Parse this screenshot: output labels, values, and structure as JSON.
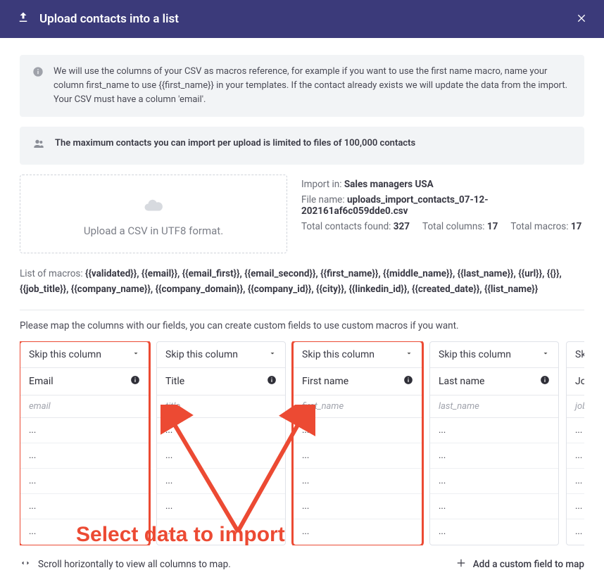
{
  "header": {
    "title": "Upload contacts into a list"
  },
  "info": {
    "text_a": "We will use the columns of your CSV as macros reference, for example if you want to use the first name macro, name your column first_name to use {{first_name}} in your templates. If the contact already exists we will update the data from the import.",
    "text_b": "Your CSV must have a column 'email'."
  },
  "limit": {
    "text": "The maximum contacts you can import per upload is limited to files of 100,000 contacts"
  },
  "upload": {
    "text": "Upload a CSV in UTF8 format."
  },
  "meta": {
    "import_in_label": "Import in: ",
    "import_in_value": "Sales managers USA",
    "file_name_label": "File name: ",
    "file_name_value": "uploads_import_contacts_07-12-202161af6c059dde0.csv",
    "total_contacts_label": "Total contacts found: ",
    "total_contacts_value": "327",
    "total_columns_label": "Total columns: ",
    "total_columns_value": "17",
    "total_macros_label": "Total macros: ",
    "total_macros_value": "17"
  },
  "macros": {
    "label": "List of macros: ",
    "value": "{{validated}}, {{email}}, {{email_first}}, {{email_second}}, {{first_name}}, {{middle_name}}, {{last_name}}, {{url}}, {{}}, {{job_title}}, {{company_name}}, {{company_domain}}, {{company_id}}, {{city}}, {{linkedin_id}}, {{created_date}}, {{list_name}}"
  },
  "hint": "Please map the columns with our fields, you can create custom fields to use custom macros if you want.",
  "dropdown_default": "Skip this column",
  "columns": [
    {
      "header": "Email",
      "slug": "email",
      "rows": [
        "...",
        "...",
        "...",
        "...",
        "..."
      ],
      "highlight": true
    },
    {
      "header": "Title",
      "slug": "title",
      "rows": [
        "...",
        "...",
        "...",
        "...",
        "..."
      ],
      "highlight": false
    },
    {
      "header": "First name",
      "slug": "first_name",
      "rows": [
        "...",
        "...",
        "...",
        "...",
        "..."
      ],
      "highlight": true
    },
    {
      "header": "Last name",
      "slug": "last_name",
      "rows": [
        "...",
        "...",
        "...",
        "...",
        "..."
      ],
      "highlight": false
    },
    {
      "header": "Job",
      "slug": "job_",
      "rows": [
        "...",
        "...",
        "...",
        "...",
        "..."
      ],
      "highlight": false
    }
  ],
  "footer": {
    "scroll_hint": "Scroll horizontally to view all columns to map.",
    "add_custom": "Add a custom field to map"
  },
  "annotation": {
    "text": "Select data to import"
  }
}
